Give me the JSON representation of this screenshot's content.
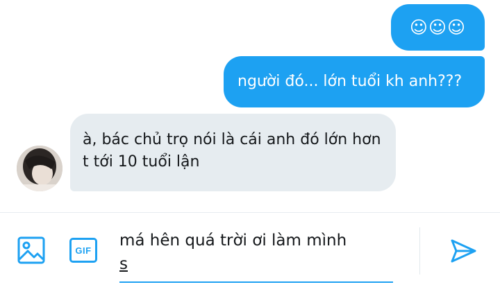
{
  "conversation": {
    "messages": [
      {
        "direction": "outgoing",
        "text": "☺☺☺"
      },
      {
        "direction": "outgoing",
        "text": "người đó... lớn tuổi kh anh???"
      },
      {
        "direction": "incoming",
        "text": "à, bác chủ trọ nói là cái anh đó lớn hơn t tới 10 tuổi lận"
      }
    ]
  },
  "composer": {
    "line1": "má hên quá trời ơi làm mình",
    "line2": "s",
    "gif_label": "GIF"
  },
  "icons": {
    "image": "image-icon",
    "gif": "gif-icon",
    "send": "send-icon",
    "avatar": "avatar"
  },
  "colors": {
    "accent": "#1da1f2",
    "incoming_bubble": "#e6ecf0",
    "text": "#14171a"
  }
}
